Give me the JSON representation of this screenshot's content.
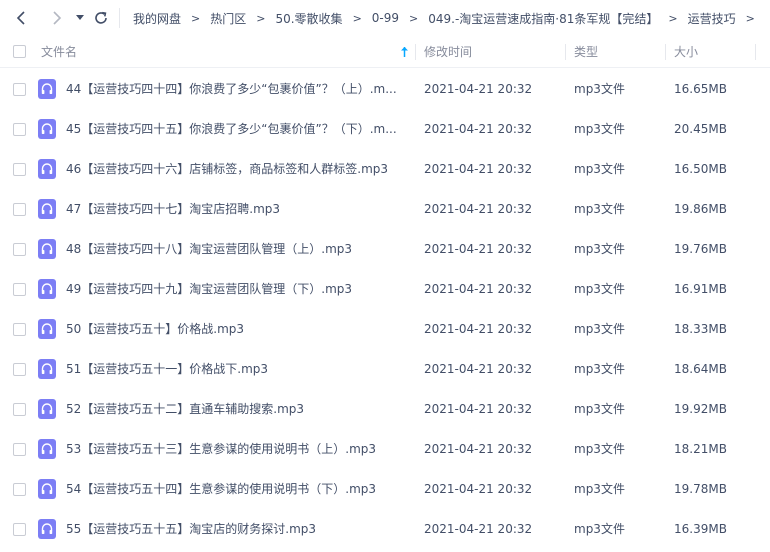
{
  "toolbar": {
    "back_icon": "chevron-left-icon",
    "forward_icon": "chevron-right-icon",
    "history_icon": "caret-down-icon",
    "refresh_icon": "refresh-icon"
  },
  "breadcrumb": [
    "我的网盘",
    "热门区",
    "50.零散收集",
    "0-99",
    "049.-淘宝运营速成指南·81条军规【完结】",
    "运营技巧"
  ],
  "breadcrumb_separator": ">",
  "columns": {
    "name": "文件名",
    "modified": "修改时间",
    "type": "类型",
    "size": "大小"
  },
  "colors": {
    "accent": "#06a7ff",
    "audio_icon": "#7c7ef5",
    "text": "#424e67",
    "muted": "#878c9c"
  },
  "files": [
    {
      "name": "44【运营技巧四十四】你浪费了多少“包裹价值”？（上）.m...",
      "modified": "2021-04-21 20:32",
      "type": "mp3文件",
      "size": "16.65MB",
      "icon": "audio-file-icon"
    },
    {
      "name": "45【运营技巧四十五】你浪费了多少“包裹价值”？（下）.m...",
      "modified": "2021-04-21 20:32",
      "type": "mp3文件",
      "size": "20.45MB",
      "icon": "audio-file-icon"
    },
    {
      "name": "46【运营技巧四十六】店铺标签，商品标签和人群标签.mp3",
      "modified": "2021-04-21 20:32",
      "type": "mp3文件",
      "size": "16.50MB",
      "icon": "audio-file-icon"
    },
    {
      "name": "47【运营技巧四十七】淘宝店招聘.mp3",
      "modified": "2021-04-21 20:32",
      "type": "mp3文件",
      "size": "19.86MB",
      "icon": "audio-file-icon"
    },
    {
      "name": "48【运营技巧四十八】淘宝运营团队管理（上）.mp3",
      "modified": "2021-04-21 20:32",
      "type": "mp3文件",
      "size": "19.76MB",
      "icon": "audio-file-icon"
    },
    {
      "name": "49【运营技巧四十九】淘宝运营团队管理（下）.mp3",
      "modified": "2021-04-21 20:32",
      "type": "mp3文件",
      "size": "16.91MB",
      "icon": "audio-file-icon"
    },
    {
      "name": "50【运营技巧五十】价格战.mp3",
      "modified": "2021-04-21 20:32",
      "type": "mp3文件",
      "size": "18.33MB",
      "icon": "audio-file-icon"
    },
    {
      "name": "51【运营技巧五十一】价格战下.mp3",
      "modified": "2021-04-21 20:32",
      "type": "mp3文件",
      "size": "18.64MB",
      "icon": "audio-file-icon"
    },
    {
      "name": "52【运营技巧五十二】直通车辅助搜索.mp3",
      "modified": "2021-04-21 20:32",
      "type": "mp3文件",
      "size": "19.92MB",
      "icon": "audio-file-icon"
    },
    {
      "name": "53【运营技巧五十三】生意参谋的使用说明书（上）.mp3",
      "modified": "2021-04-21 20:32",
      "type": "mp3文件",
      "size": "18.21MB",
      "icon": "audio-file-icon"
    },
    {
      "name": "54【运营技巧五十四】生意参谋的使用说明书（下）.mp3",
      "modified": "2021-04-21 20:32",
      "type": "mp3文件",
      "size": "19.78MB",
      "icon": "audio-file-icon"
    },
    {
      "name": "55【运营技巧五十五】淘宝店的财务探讨.mp3",
      "modified": "2021-04-21 20:32",
      "type": "mp3文件",
      "size": "16.39MB",
      "icon": "audio-file-icon"
    }
  ]
}
